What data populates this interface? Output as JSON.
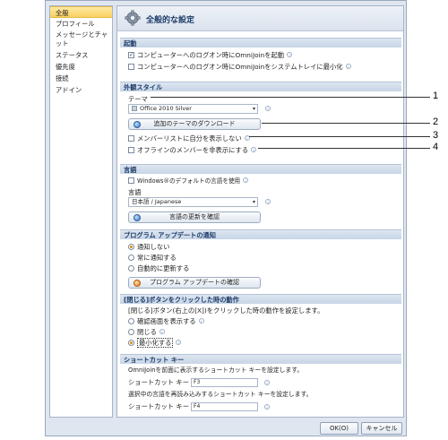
{
  "sidebar": {
    "items": [
      {
        "label": "全般",
        "active": true
      },
      {
        "label": "プロフィール"
      },
      {
        "label": "メッセージとチャット"
      },
      {
        "label": "ステータス"
      },
      {
        "label": "優先度"
      },
      {
        "label": "接続"
      },
      {
        "label": "アドイン"
      }
    ]
  },
  "header": {
    "title": "全般的な設定",
    "icon": "gear-icon"
  },
  "startup": {
    "title": "起動",
    "opt1": "コンピューターへのログオン時にOmniJoinを起動",
    "opt1_checked": true,
    "opt2": "コンピューターへのログオン時にOmniJoinをシステムトレイに最小化",
    "opt2_checked": false
  },
  "appearance": {
    "title": "外観スタイル",
    "theme_label": "テーマ",
    "theme_value": "Office 2010 Silver",
    "download_button": "追加のテーマのダウンロード",
    "hide_self": "メンバーリストに自分を表示しない",
    "hide_offline": "オフラインのメンバーを非表示にする"
  },
  "language": {
    "title": "言語",
    "use_windows": "Windows®のデフォルトの言語を使用",
    "label": "言語",
    "value": "日本語 / Japanese",
    "update_button": "言語の更新を確認"
  },
  "program_update": {
    "title": "プログラム アップデートの通知",
    "options": [
      "通知しない",
      "常に通知する",
      "自動的に更新する"
    ],
    "selected": 0,
    "check_button": "プログラム アップデートの確認"
  },
  "close_action": {
    "title": "[閉じる]ボタンをクリックした時の動作",
    "description": "[閉じる]ボタン(右上の[X])をクリックした時の動作を設定します。",
    "options": [
      "確認画面を表示する",
      "閉じる",
      "最小化する"
    ],
    "selected": 2
  },
  "shortcut": {
    "title": "ショートカット キー",
    "desc1": "OmniJoinを前面に表示するショートカット キーを設定します。",
    "key_label": "ショートカット キー",
    "key1": "F3",
    "desc2": "選択中の言語を再読み込みするショートカット キーを設定します。",
    "key2": "F4"
  },
  "footer": {
    "ok": "OK(O)",
    "cancel": "キャンセル"
  },
  "callouts": [
    "1",
    "2",
    "3",
    "4"
  ],
  "colors": {
    "section_text": "#1c3b67",
    "active_tab": "#f9d160",
    "accent_radio": "#e28b18"
  }
}
